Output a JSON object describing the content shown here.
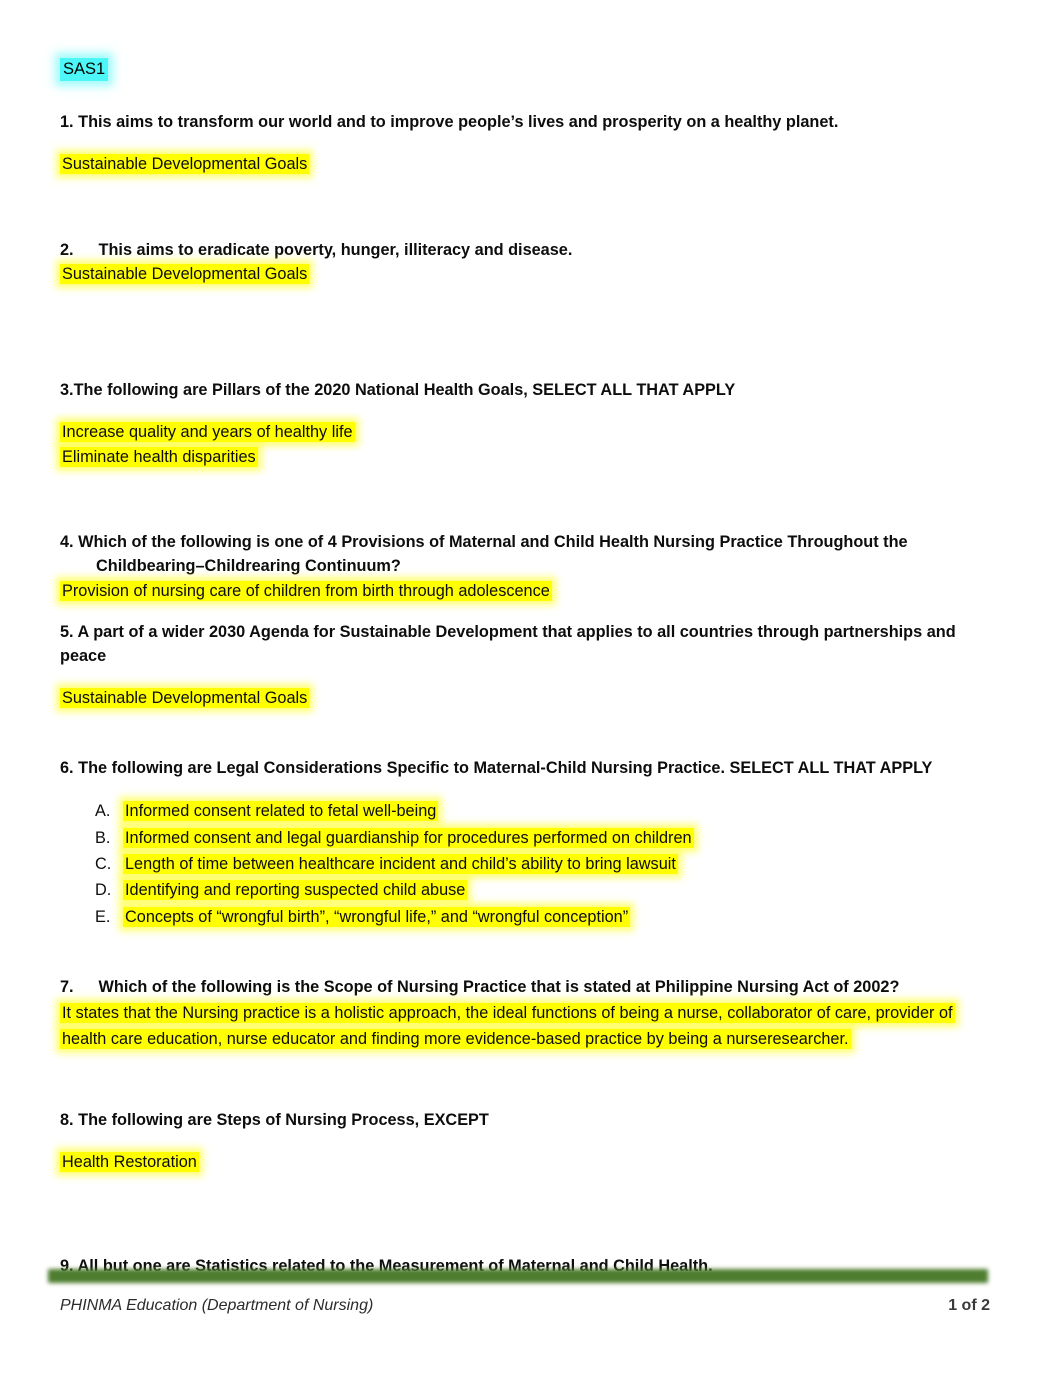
{
  "document": {
    "tag": "SAS1"
  },
  "questions": [
    {
      "number": "1.",
      "style": "inline",
      "text": "This aims to transform our world and to improve people’s lives and prosperity on a healthy planet.",
      "answers": [
        "Sustainable Developmental Goals"
      ]
    },
    {
      "number": "2.",
      "style": "tab",
      "text": "This aims to eradicate poverty, hunger, illiteracy and disease.",
      "answers": [
        "Sustainable Developmental Goals"
      ]
    },
    {
      "number": "3.",
      "style": "tight",
      "text": "The following are Pillars of the 2020 National Health Goals, SELECT ALL THAT APPLY",
      "answers": [
        " Increase quality and years of healthy life",
        "Eliminate health disparities"
      ]
    },
    {
      "number": "4.",
      "style": "inline",
      "text": "Which of the following is one of 4 Provisions of Maternal and Child Health Nursing Practice Throughout the",
      "text_line2": "Childbearing–Childrearing Continuum?",
      "answers": [
        "Provision of nursing care of children from birth through adolescence"
      ]
    },
    {
      "number": "5.",
      "style": "inline",
      "text": "A part of a wider 2030 Agenda for Sustainable Development that applies to all countries through partnerships and peace",
      "answers": [
        "Sustainable Developmental Goals"
      ]
    },
    {
      "number": "6.",
      "style": "inline",
      "text": "The following are Legal Considerations Specific to Maternal-Child Nursing Practice. SELECT ALL THAT APPLY",
      "options": [
        {
          "letter": "A.",
          "text": "Informed consent related to fetal well-being"
        },
        {
          "letter": "B.",
          "text": "Informed consent and legal guardianship for procedures performed on children"
        },
        {
          "letter": "C.",
          "text": "Length of time between healthcare incident and child’s ability to bring lawsuit"
        },
        {
          "letter": "D.",
          "text": "Identifying and reporting suspected child abuse"
        },
        {
          "letter": "E.",
          "text": "Concepts of “wrongful birth”, “wrongful life,” and “wrongful conception”"
        }
      ]
    },
    {
      "number": "7.",
      "style": "tab",
      "text": "Which of the following is the Scope of Nursing Practice that is stated at Philippine Nursing Act of 2002?",
      "answer_paragraph": "It states that the Nursing practice is a holistic approach, the ideal functions of being a nurse, collaborator of care, provider of health care education, nurse educator and finding more evidence-based practice by being a nurseresearcher."
    },
    {
      "number": "8.",
      "style": "inline",
      "text": "The following are Steps of Nursing Process, EXCEPT",
      "answers": [
        "Health Restoration"
      ]
    },
    {
      "number": "9.",
      "style": "inline",
      "text": "All but one are Statistics related to the Measurement of Maternal and Child Health.",
      "answers": []
    }
  ],
  "footer": {
    "left": "PHINMA Education (Department of Nursing)",
    "right": "1 of 2"
  },
  "colors": {
    "highlight_yellow": "#ffff00",
    "highlight_cyan": "#4df7f7",
    "footer_bar_green": "#4e7d30"
  }
}
